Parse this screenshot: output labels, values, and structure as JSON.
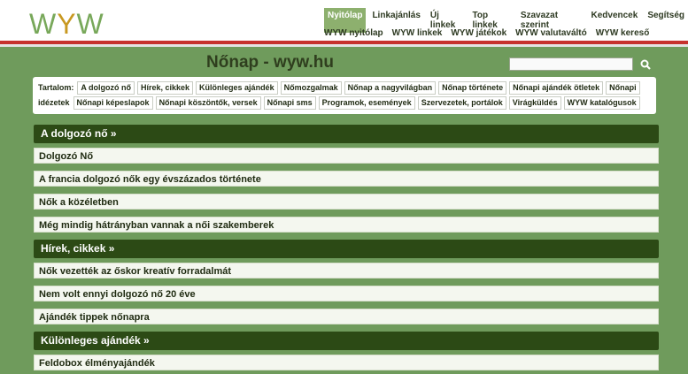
{
  "logo": {
    "part1": "W",
    "part2": "Y",
    "part3": "W"
  },
  "topnav": [
    "Nyitólap",
    "Linkajánlás",
    "Új linkek",
    "Top linkek",
    "Szavazat szerint",
    "Kedvencek",
    "Segítség"
  ],
  "subnav": [
    "WYW nyitólap",
    "WYW linkek",
    "WYW játékok",
    "WYW valutaváltó",
    "WYW kereső"
  ],
  "page_title": "Nőnap - wyw.hu",
  "search": {
    "placeholder": "",
    "icon": "search-icon"
  },
  "toc": {
    "label": "Tartalom:",
    "row1": [
      "A dolgozó nő",
      "Hírek, cikkek",
      "Különleges ajándék",
      "Nőmozgalmak",
      "Nőnap a nagyvilágban",
      "Nőnap története",
      "Nőnapi ajándék ötletek",
      "Nőnapi"
    ],
    "row2_first": "idézetek",
    "row2": [
      "Nőnapi képeslapok",
      "Nőnapi köszöntők, versek",
      "Nőnapi sms",
      "Programok, események",
      "Szervezetek, portálok",
      "Virágküldés",
      "WYW katalógusok"
    ]
  },
  "sections": [
    {
      "title": "A dolgozó nő »",
      "items": [
        "Dolgozó Nő",
        "A francia dolgozó nők egy évszázados története",
        "Nők a közéletben",
        "Még mindig hátrányban vannak a női szakemberek"
      ]
    },
    {
      "title": "Hírek, cikkek »",
      "items": [
        "Nők vezették az őskor kreatív forradalmát",
        "Nem volt ennyi dolgozó nő 20 éve",
        "Ajándék tippek nőnapra"
      ]
    },
    {
      "title": "Különleges ajándék »",
      "items": [
        "Feldobox élményajándék"
      ]
    }
  ],
  "colors": {
    "background": "#6f9b5c",
    "section_bar": "#2c4a15",
    "red_line": "#c6322e",
    "active_nav": "#8db06e"
  }
}
